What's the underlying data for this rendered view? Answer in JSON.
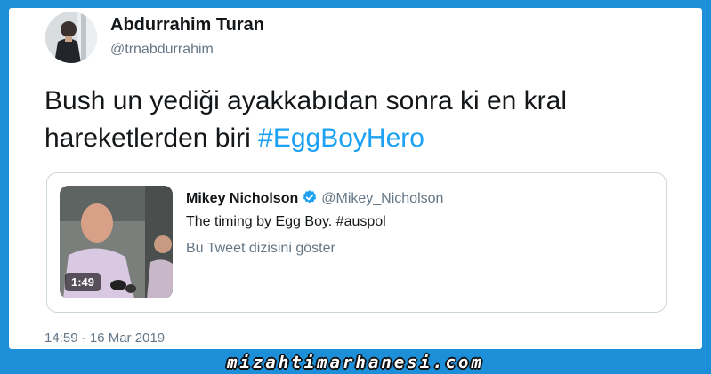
{
  "author": {
    "name": "Abdurrahim Turan",
    "handle": "@trnabdurrahim"
  },
  "tweet": {
    "text_line1": "Bush un yediği ayakkabıdan sonra ki en kral",
    "text_line2_prefix": "hareketlerden biri ",
    "hashtag": "#EggBoyHero"
  },
  "quoted_tweet": {
    "name": "Mikey Nicholson",
    "handle": "@Mikey_Nicholson",
    "text": "The timing by Egg Boy. #auspol",
    "thread_link": "Bu Tweet dizisini göster",
    "video_duration": "1:49",
    "verified_icon": "verified-badge-icon"
  },
  "timestamp": "14:59 - 16 Mar 2019",
  "watermark": "mizahtimarhanesi.com",
  "colors": {
    "background": "#1d8fd8",
    "hashtag": "#1da1f2",
    "verified": "#1da1f2",
    "secondary_text": "#657786"
  }
}
